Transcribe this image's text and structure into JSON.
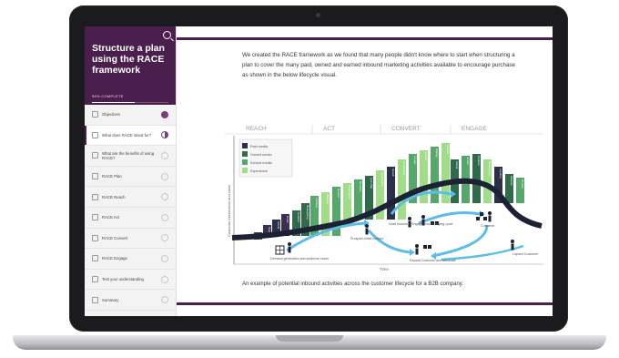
{
  "sidebar": {
    "title": "Structure a plan using the RACE framework",
    "progress_label": "56% COMPLETE",
    "progress": 0.56,
    "items": [
      {
        "label": "Objectives",
        "status": "done"
      },
      {
        "label": "What does RACE stand for?",
        "status": "half",
        "active": true
      },
      {
        "label": "What are the benefits of using RACE?",
        "status": "none"
      },
      {
        "label": "RACE Plan",
        "status": "none"
      },
      {
        "label": "RACE Reach",
        "status": "none"
      },
      {
        "label": "RACE Act",
        "status": "none"
      },
      {
        "label": "RACE Convert",
        "status": "none"
      },
      {
        "label": "RACE Engage",
        "status": "none"
      },
      {
        "label": "Test your understanding",
        "status": "none"
      },
      {
        "label": "Summary",
        "status": "none"
      }
    ]
  },
  "main": {
    "paragraph": "We created the RACE framework as we found that many people didn't know where to start when structuring a plan to cover the many paid, owned and earned inbound marketing activities available to encourage purchase as shown in the below lifecycle visual.",
    "caption": "An example of potential inbound activities across the customer lifecycle for a B2B company."
  },
  "figure": {
    "phases": [
      "REACH",
      "ACT",
      "CONVERT",
      "ENGAGE"
    ],
    "legend": [
      {
        "label": "Paid media",
        "color": "#2a2f4a"
      },
      {
        "label": "Owned media",
        "color": "#2f6b4b"
      },
      {
        "label": "Earned media",
        "color": "#55a86a"
      },
      {
        "label": "Experience",
        "color": "#9fdd86"
      }
    ],
    "y_axis_label": "Customer interactions and value",
    "x_axis_label": "Time",
    "bar_labels": [
      "Display",
      "Search",
      "Social",
      "Email",
      "Content",
      "Retargeting",
      "Landing",
      "Website",
      "Nurture",
      "Personalise",
      "Reviews",
      "Live chat",
      "Onboarding",
      "Upsell",
      "Community",
      "Loyalty",
      "Events"
    ],
    "annotations": [
      "Demand generation and audience reach",
      "Prospect initial contact",
      "Lead Nurture + Engage prior to buying cycle",
      "Repeat Customer and advocate",
      "Customer",
      "Lapsed Customer"
    ]
  }
}
